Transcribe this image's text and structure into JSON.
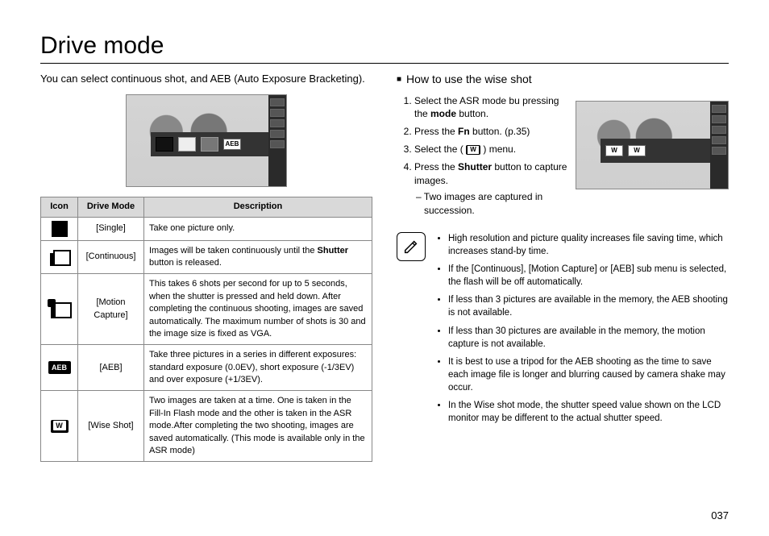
{
  "title": "Drive mode",
  "intro": "You can select continuous shot, and AEB (Auto Exposure Bracketing).",
  "table": {
    "headers": {
      "icon": "Icon",
      "mode": "Drive Mode",
      "desc": "Description"
    },
    "rows": [
      {
        "mode": "[Single]",
        "desc_parts": [
          "Take one picture only."
        ]
      },
      {
        "mode": "[Continuous]",
        "desc_parts": [
          "Images will be taken continuously until the ",
          "Shutter",
          " button is released."
        ]
      },
      {
        "mode": "[Motion Capture]",
        "desc_parts": [
          "This takes 6 shots per second for up to 5 seconds, when the shutter is pressed and held down. After completing the continuous shooting, images are saved automatically. The maximum number of shots is 30 and the image size is fixed as VGA."
        ]
      },
      {
        "mode": "[AEB]",
        "desc_parts": [
          "Take three pictures in a series in different exposures: standard exposure (0.0EV), short exposure (-1/3EV) and over exposure (+1/3EV)."
        ]
      },
      {
        "mode": "[Wise Shot]",
        "desc_parts": [
          "Two images are taken at a time. One is taken in the Fill-In Flash mode and the other is taken in the ASR mode.After completing the two shooting, images are saved automatically. (This mode is available only in the ASR mode)"
        ]
      }
    ],
    "aeb_label": "AEB"
  },
  "right": {
    "heading": "How to use the wise shot",
    "steps": {
      "s1a": "Select the ASR mode bu pressing the ",
      "s1b": "mode",
      "s1c": " button.",
      "s2a": "Press the ",
      "s2b": "Fn",
      "s2c": " button. (p.35)",
      "s3a": "Select the ( ",
      "s3b": " ) menu.",
      "s4a": "Press the ",
      "s4b": "Shutter",
      "s4c": " button to capture images.",
      "s4sub": "Two images are captured in succession."
    },
    "notes": [
      "High resolution and picture quality increases file saving time, which increases stand-by time.",
      "If the [Continuous], [Motion Capture] or [AEB] sub menu is selected, the flash will be off automatically.",
      "If less than 3 pictures are available in the memory, the AEB shooting is not available.",
      "If less than 30 pictures are available in the memory, the motion capture is not available.",
      "It is best to use a tripod for the AEB shooting as the time to save each image file is longer and blurring caused by camera shake may occur.",
      "In the Wise shot mode, the shutter speed value shown on the LCD monitor may be different to the actual shutter speed."
    ]
  },
  "page": "037"
}
